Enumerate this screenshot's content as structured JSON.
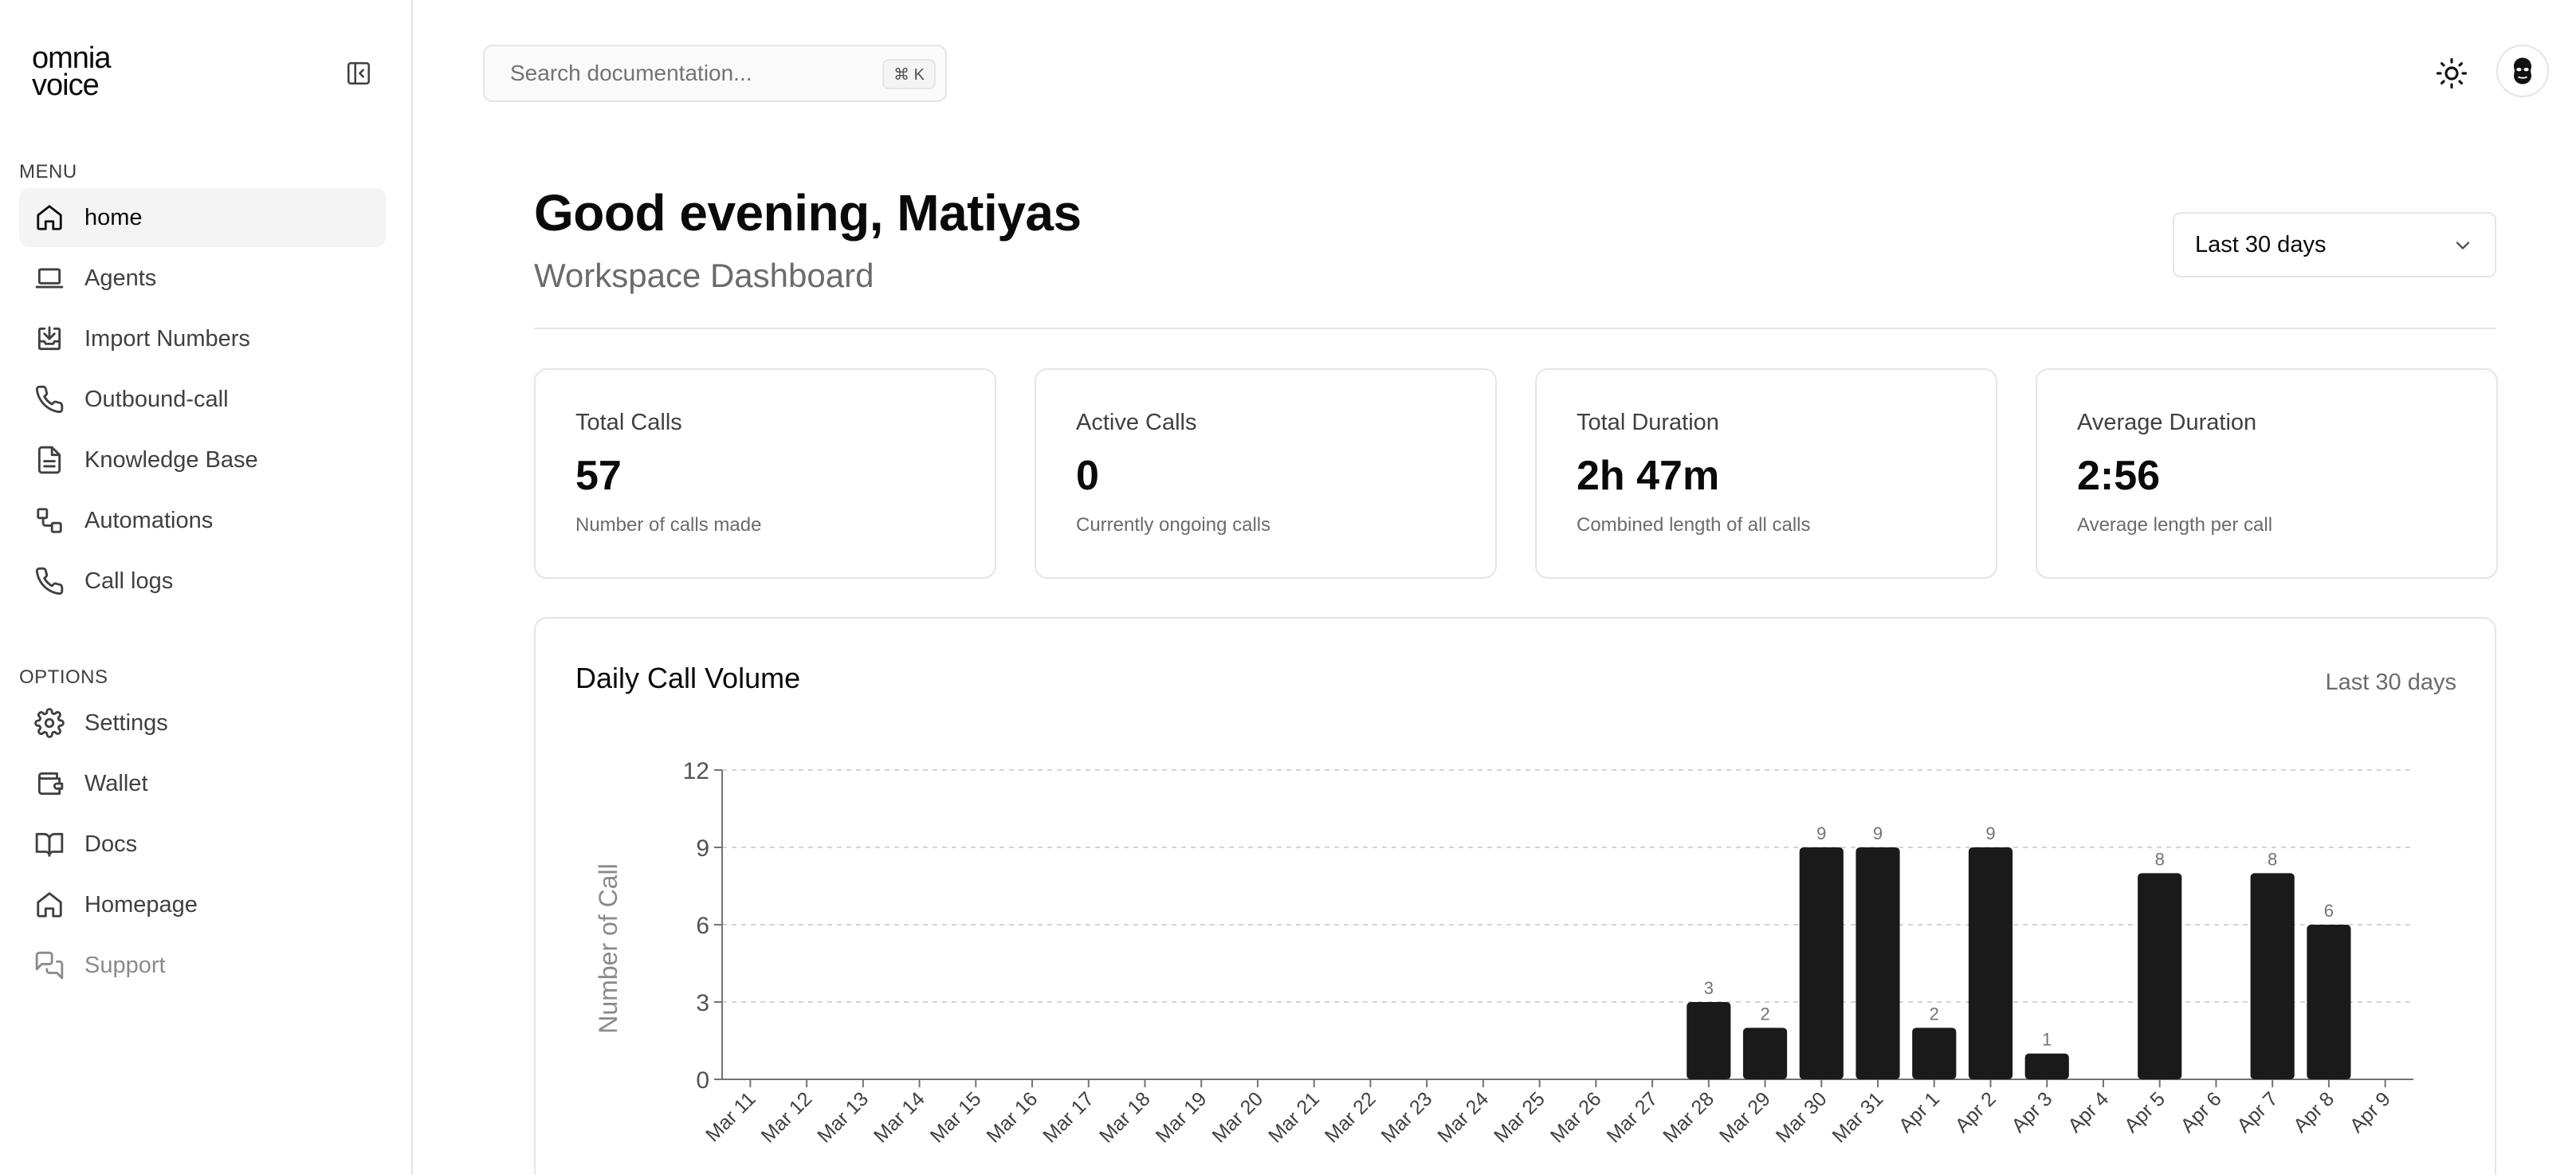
{
  "app": {
    "logo_line1": "omnia",
    "logo_line2": "voice"
  },
  "sidebar": {
    "menu_label": "MENU",
    "menu_items": [
      {
        "label": "home",
        "icon": "home-icon",
        "active": true
      },
      {
        "label": "Agents",
        "icon": "laptop-icon"
      },
      {
        "label": "Import Numbers",
        "icon": "import-icon"
      },
      {
        "label": "Outbound-call",
        "icon": "phone-icon"
      },
      {
        "label": "Knowledge Base",
        "icon": "file-text-icon"
      },
      {
        "label": "Automations",
        "icon": "workflow-icon"
      },
      {
        "label": "Call logs",
        "icon": "phone-icon"
      }
    ],
    "options_label": "OPTIONS",
    "option_items": [
      {
        "label": "Settings",
        "icon": "gear-icon"
      },
      {
        "label": "Wallet",
        "icon": "wallet-icon"
      },
      {
        "label": "Docs",
        "icon": "book-icon"
      },
      {
        "label": "Homepage",
        "icon": "home-icon"
      },
      {
        "label": "Support",
        "icon": "chat-icon",
        "muted": true
      }
    ]
  },
  "topbar": {
    "search_placeholder": "Search documentation...",
    "search_shortcut": "⌘ K"
  },
  "header": {
    "greeting": "Good evening, Matiyas",
    "subtitle": "Workspace Dashboard",
    "range": "Last 30 days"
  },
  "stats": [
    {
      "label": "Total Calls",
      "value": "57",
      "desc": "Number of calls made"
    },
    {
      "label": "Active Calls",
      "value": "0",
      "desc": "Currently ongoing calls"
    },
    {
      "label": "Total Duration",
      "value": "2h 47m",
      "desc": "Combined length of all calls"
    },
    {
      "label": "Average Duration",
      "value": "2:56",
      "desc": "Average length per call"
    }
  ],
  "chart": {
    "title": "Daily Call Volume",
    "range": "Last 30 days"
  },
  "chart_data": {
    "type": "bar",
    "title": "Daily Call Volume",
    "xlabel": "",
    "ylabel": "Number of Call",
    "ylim": [
      0,
      12
    ],
    "yticks": [
      0,
      3,
      6,
      9,
      12
    ],
    "grid": true,
    "bar_color": "#1a1a1a",
    "categories": [
      "Mar 11",
      "Mar 12",
      "Mar 13",
      "Mar 14",
      "Mar 15",
      "Mar 16",
      "Mar 17",
      "Mar 18",
      "Mar 19",
      "Mar 20",
      "Mar 21",
      "Mar 22",
      "Mar 23",
      "Mar 24",
      "Mar 25",
      "Mar 26",
      "Mar 27",
      "Mar 28",
      "Mar 29",
      "Mar 30",
      "Mar 31",
      "Apr 1",
      "Apr 2",
      "Apr 3",
      "Apr 4",
      "Apr 5",
      "Apr 6",
      "Apr 7",
      "Apr 8",
      "Apr 9"
    ],
    "values": [
      0,
      0,
      0,
      0,
      0,
      0,
      0,
      0,
      0,
      0,
      0,
      0,
      0,
      0,
      0,
      0,
      0,
      3,
      2,
      9,
      9,
      2,
      9,
      1,
      0,
      8,
      0,
      8,
      6,
      0
    ]
  }
}
